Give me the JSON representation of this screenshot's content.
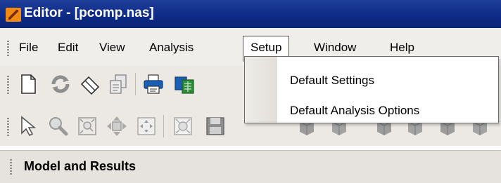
{
  "window": {
    "title": "Editor - [pcomp.nas]"
  },
  "menubar": {
    "items": [
      {
        "label": "File"
      },
      {
        "label": "Edit"
      },
      {
        "label": "View"
      },
      {
        "label": "Analysis"
      },
      {
        "label": "Setup",
        "active": true
      },
      {
        "label": "Window"
      },
      {
        "label": "Help"
      }
    ]
  },
  "setup_menu": {
    "items": [
      {
        "label": "Default Settings"
      },
      {
        "label": "Default Analysis Options"
      }
    ]
  },
  "toolbar1": {
    "icons": [
      "new-file-icon",
      "refresh-icon",
      "eraser-icon",
      "copy-document-icon",
      "print-icon",
      "spreadsheet-icon"
    ]
  },
  "toolbar2": {
    "icons": [
      "pointer-icon",
      "zoom-icon",
      "zoom-fit-icon",
      "pan-rotate-icon",
      "move-icon",
      "zoom-extents-icon",
      "save-icon"
    ]
  },
  "panel": {
    "title": "Model and Results"
  },
  "colors": {
    "titlebar": "#0d2a85",
    "menubar": "#f0eeea",
    "toolbar": "#ece9e4",
    "accent_blue": "#1a5fb4",
    "accent_green": "#2e8b3a"
  }
}
